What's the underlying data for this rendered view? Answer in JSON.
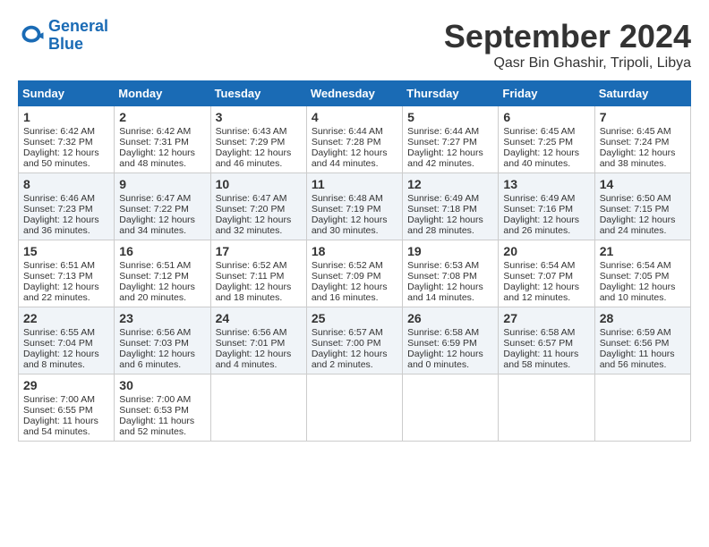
{
  "header": {
    "logo_line1": "General",
    "logo_line2": "Blue",
    "month_title": "September 2024",
    "location": "Qasr Bin Ghashir, Tripoli, Libya"
  },
  "weekdays": [
    "Sunday",
    "Monday",
    "Tuesday",
    "Wednesday",
    "Thursday",
    "Friday",
    "Saturday"
  ],
  "weeks": [
    [
      {
        "day": "1",
        "lines": [
          "Sunrise: 6:42 AM",
          "Sunset: 7:32 PM",
          "Daylight: 12 hours",
          "and 50 minutes."
        ]
      },
      {
        "day": "2",
        "lines": [
          "Sunrise: 6:42 AM",
          "Sunset: 7:31 PM",
          "Daylight: 12 hours",
          "and 48 minutes."
        ]
      },
      {
        "day": "3",
        "lines": [
          "Sunrise: 6:43 AM",
          "Sunset: 7:29 PM",
          "Daylight: 12 hours",
          "and 46 minutes."
        ]
      },
      {
        "day": "4",
        "lines": [
          "Sunrise: 6:44 AM",
          "Sunset: 7:28 PM",
          "Daylight: 12 hours",
          "and 44 minutes."
        ]
      },
      {
        "day": "5",
        "lines": [
          "Sunrise: 6:44 AM",
          "Sunset: 7:27 PM",
          "Daylight: 12 hours",
          "and 42 minutes."
        ]
      },
      {
        "day": "6",
        "lines": [
          "Sunrise: 6:45 AM",
          "Sunset: 7:25 PM",
          "Daylight: 12 hours",
          "and 40 minutes."
        ]
      },
      {
        "day": "7",
        "lines": [
          "Sunrise: 6:45 AM",
          "Sunset: 7:24 PM",
          "Daylight: 12 hours",
          "and 38 minutes."
        ]
      }
    ],
    [
      {
        "day": "8",
        "lines": [
          "Sunrise: 6:46 AM",
          "Sunset: 7:23 PM",
          "Daylight: 12 hours",
          "and 36 minutes."
        ]
      },
      {
        "day": "9",
        "lines": [
          "Sunrise: 6:47 AM",
          "Sunset: 7:22 PM",
          "Daylight: 12 hours",
          "and 34 minutes."
        ]
      },
      {
        "day": "10",
        "lines": [
          "Sunrise: 6:47 AM",
          "Sunset: 7:20 PM",
          "Daylight: 12 hours",
          "and 32 minutes."
        ]
      },
      {
        "day": "11",
        "lines": [
          "Sunrise: 6:48 AM",
          "Sunset: 7:19 PM",
          "Daylight: 12 hours",
          "and 30 minutes."
        ]
      },
      {
        "day": "12",
        "lines": [
          "Sunrise: 6:49 AM",
          "Sunset: 7:18 PM",
          "Daylight: 12 hours",
          "and 28 minutes."
        ]
      },
      {
        "day": "13",
        "lines": [
          "Sunrise: 6:49 AM",
          "Sunset: 7:16 PM",
          "Daylight: 12 hours",
          "and 26 minutes."
        ]
      },
      {
        "day": "14",
        "lines": [
          "Sunrise: 6:50 AM",
          "Sunset: 7:15 PM",
          "Daylight: 12 hours",
          "and 24 minutes."
        ]
      }
    ],
    [
      {
        "day": "15",
        "lines": [
          "Sunrise: 6:51 AM",
          "Sunset: 7:13 PM",
          "Daylight: 12 hours",
          "and 22 minutes."
        ]
      },
      {
        "day": "16",
        "lines": [
          "Sunrise: 6:51 AM",
          "Sunset: 7:12 PM",
          "Daylight: 12 hours",
          "and 20 minutes."
        ]
      },
      {
        "day": "17",
        "lines": [
          "Sunrise: 6:52 AM",
          "Sunset: 7:11 PM",
          "Daylight: 12 hours",
          "and 18 minutes."
        ]
      },
      {
        "day": "18",
        "lines": [
          "Sunrise: 6:52 AM",
          "Sunset: 7:09 PM",
          "Daylight: 12 hours",
          "and 16 minutes."
        ]
      },
      {
        "day": "19",
        "lines": [
          "Sunrise: 6:53 AM",
          "Sunset: 7:08 PM",
          "Daylight: 12 hours",
          "and 14 minutes."
        ]
      },
      {
        "day": "20",
        "lines": [
          "Sunrise: 6:54 AM",
          "Sunset: 7:07 PM",
          "Daylight: 12 hours",
          "and 12 minutes."
        ]
      },
      {
        "day": "21",
        "lines": [
          "Sunrise: 6:54 AM",
          "Sunset: 7:05 PM",
          "Daylight: 12 hours",
          "and 10 minutes."
        ]
      }
    ],
    [
      {
        "day": "22",
        "lines": [
          "Sunrise: 6:55 AM",
          "Sunset: 7:04 PM",
          "Daylight: 12 hours",
          "and 8 minutes."
        ]
      },
      {
        "day": "23",
        "lines": [
          "Sunrise: 6:56 AM",
          "Sunset: 7:03 PM",
          "Daylight: 12 hours",
          "and 6 minutes."
        ]
      },
      {
        "day": "24",
        "lines": [
          "Sunrise: 6:56 AM",
          "Sunset: 7:01 PM",
          "Daylight: 12 hours",
          "and 4 minutes."
        ]
      },
      {
        "day": "25",
        "lines": [
          "Sunrise: 6:57 AM",
          "Sunset: 7:00 PM",
          "Daylight: 12 hours",
          "and 2 minutes."
        ]
      },
      {
        "day": "26",
        "lines": [
          "Sunrise: 6:58 AM",
          "Sunset: 6:59 PM",
          "Daylight: 12 hours",
          "and 0 minutes."
        ]
      },
      {
        "day": "27",
        "lines": [
          "Sunrise: 6:58 AM",
          "Sunset: 6:57 PM",
          "Daylight: 11 hours",
          "and 58 minutes."
        ]
      },
      {
        "day": "28",
        "lines": [
          "Sunrise: 6:59 AM",
          "Sunset: 6:56 PM",
          "Daylight: 11 hours",
          "and 56 minutes."
        ]
      }
    ],
    [
      {
        "day": "29",
        "lines": [
          "Sunrise: 7:00 AM",
          "Sunset: 6:55 PM",
          "Daylight: 11 hours",
          "and 54 minutes."
        ]
      },
      {
        "day": "30",
        "lines": [
          "Sunrise: 7:00 AM",
          "Sunset: 6:53 PM",
          "Daylight: 11 hours",
          "and 52 minutes."
        ]
      },
      null,
      null,
      null,
      null,
      null
    ]
  ]
}
